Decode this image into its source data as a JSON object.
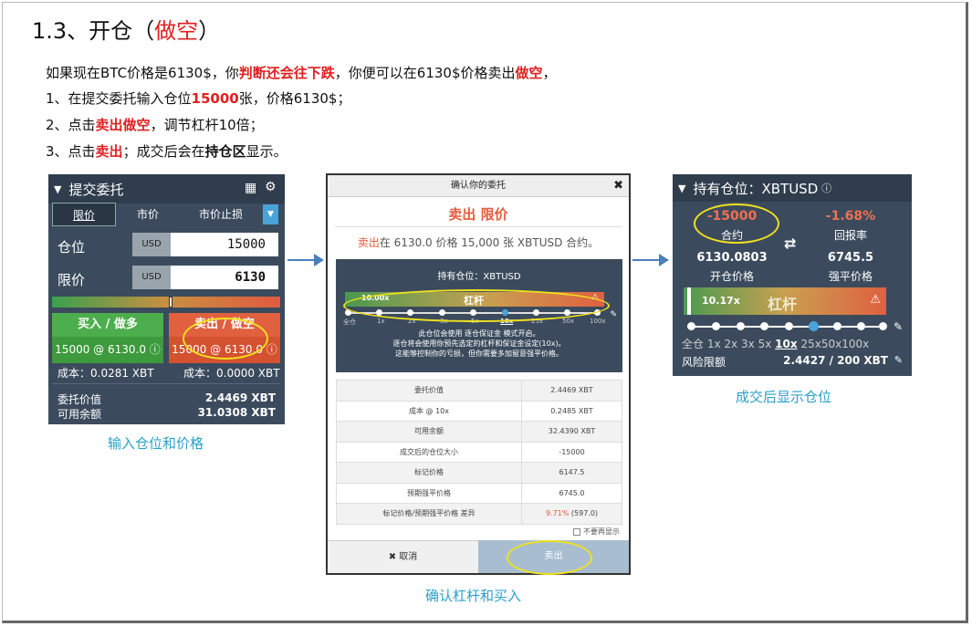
{
  "title_prefix": "1.3、开仓（",
  "title_red": "做空",
  "title_suffix": "）",
  "line1": {
    "a": "如果现在BTC价格是6130$，你",
    "b": "判断还会往下跌",
    "c": "，你便可以在6130$价格卖出",
    "d": "做空",
    "e": "，"
  },
  "line2": {
    "a": "1、在提交委托输入仓位",
    "b": "15000",
    "c": "张，价格6130$；"
  },
  "line3": {
    "a": "2、点击",
    "b": "卖出做空",
    "c": "，调节杠杆10倍；"
  },
  "line4": {
    "a": "3、点击",
    "b": "卖出",
    "c": "；成交后会在",
    "d": "持仓区",
    "e": "显示。"
  },
  "p1": {
    "header": "提交委托",
    "tabs": [
      "限价",
      "市价",
      "市价止损"
    ],
    "qty_label": "仓位",
    "price_label": "限价",
    "unit": "USD",
    "qty": "15000",
    "price": "6130",
    "buy_label": "买入 / 做多",
    "buy_sub": "15000 @ 6130.0",
    "sell_label": "卖出 / 做空",
    "sell_sub": "15000 @ 6130.0",
    "buy_cost": "成本：0.0281 XBT",
    "sell_cost": "成本：0.0000 XBT",
    "order_value_label": "委托价值",
    "order_value": "2.4469 XBT",
    "avail_label": "可用余额",
    "avail": "31.0308 XBT",
    "caption": "输入仓位和价格"
  },
  "p2": {
    "header": "确认你的委托",
    "side_title": "卖出 限价",
    "sub_red": "卖出",
    "sub_rest": "在 6130.0 价格  15,000 张 XBTUSD 合约。",
    "inner_header": "持有仓位：XBTUSD",
    "lev_value": "10.00x",
    "lev_label": "杠杆",
    "ticks": [
      "全仓",
      "1x",
      "2x",
      "3x",
      "5x",
      "10x",
      "25x",
      "50x",
      "100x"
    ],
    "note1": "此仓位会使用 逐仓保证金 模式开启。",
    "note2": "逐仓将会使用你预先选定的杠杆和保证金设定(10x)。",
    "note3": "这能够控制你的亏损，但你需要多加留意强平价格。",
    "rows": [
      {
        "k": "委托价值",
        "v": "2.4469 XBT"
      },
      {
        "k": "成本 @ 10x",
        "v": "0.2485 XBT"
      },
      {
        "k": "可用余额",
        "v": "32.4390 XBT"
      },
      {
        "k": "成交后的仓位大小",
        "v": "-15000"
      },
      {
        "k": "标记价格",
        "v": "6147.5"
      },
      {
        "k": "预期强平价格",
        "v": "6745.0"
      },
      {
        "k": "标记价格/预期强平价格 差异",
        "v_red": "9.71%",
        "v": " (597.0)"
      }
    ],
    "noshow": "不要再显示",
    "cancel": "✖ 取消",
    "sell": "卖出",
    "caption": "确认杠杆和买入"
  },
  "p3": {
    "header": "持有仓位：XBTUSD",
    "contracts": "-15000",
    "contracts_label": "合约",
    "roe": "-1.68%",
    "roe_label": "回报率",
    "entry": "6130.0803",
    "entry_label": "开仓价格",
    "liq": "6745.5",
    "liq_label": "强平价格",
    "lev_value": "10.17x",
    "lev_label": "杠杆",
    "ticks": [
      "全仓",
      "1x",
      "2x",
      "3x",
      "5x",
      "10x",
      "25x",
      "50x",
      "100x"
    ],
    "risk_label": "风险限额",
    "risk_value": "2.4427 / 200 XBT",
    "caption": "成交后显示仓位"
  }
}
